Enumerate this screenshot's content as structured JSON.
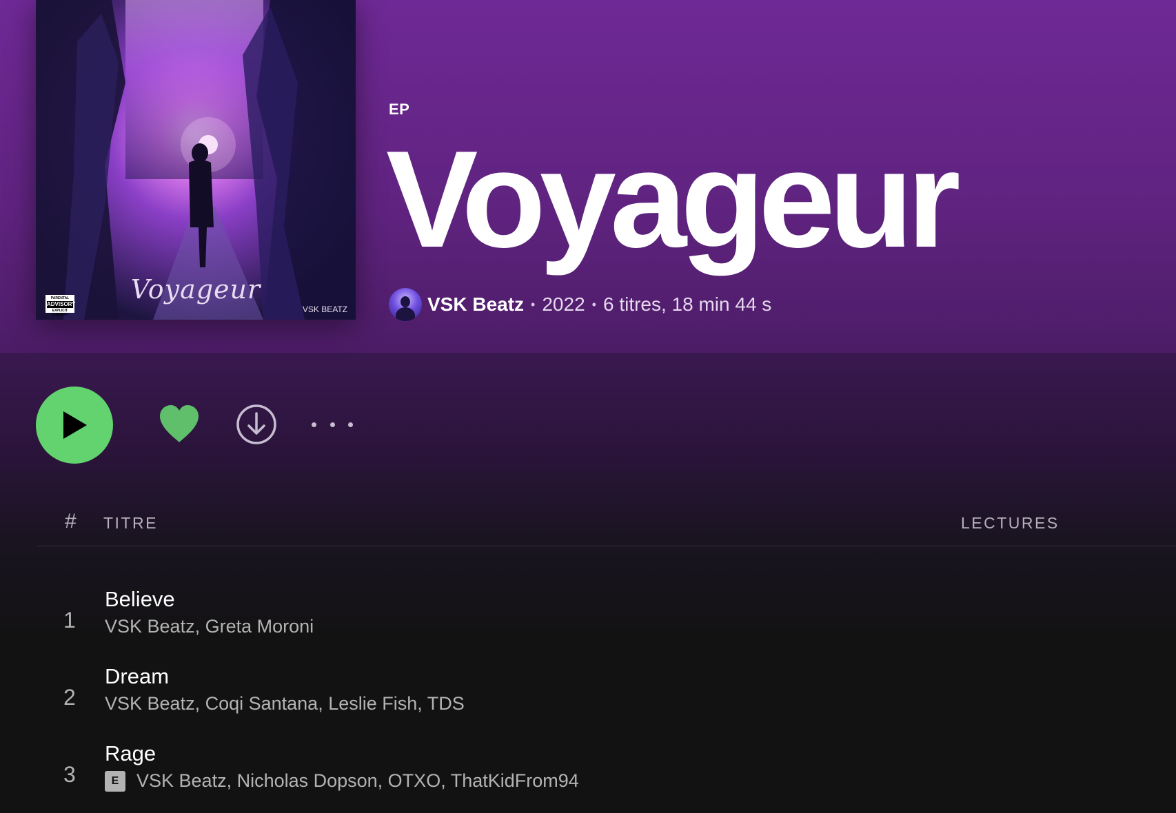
{
  "album": {
    "type": "EP",
    "title": "Voyageur",
    "cover": {
      "title_text": "Voyageur",
      "artist_text": "VSK BEATZ",
      "advisory_top": "PARENTAL",
      "advisory_mid": "ADVISORY",
      "advisory_bottom": "EXPLICIT CONTENT"
    },
    "artist": "VSK Beatz",
    "year": "2022",
    "summary": "6 titres, 18 min 44 s",
    "separator": "•"
  },
  "actions": {
    "play_icon": "play-icon",
    "like_icon": "heart-icon",
    "download_icon": "download-icon",
    "more_icon": "more-icon",
    "accent_color": "#62d36f"
  },
  "table": {
    "headers": {
      "number": "#",
      "title": "TITRE",
      "plays": "LECTURES"
    },
    "tracks": [
      {
        "number": "1",
        "title": "Believe",
        "artists": "VSK Beatz, Greta Moroni",
        "explicit": false
      },
      {
        "number": "2",
        "title": "Dream",
        "artists": "VSK Beatz, Coqi Santana, Leslie Fish, TDS",
        "explicit": false
      },
      {
        "number": "3",
        "title": "Rage",
        "artists": "VSK Beatz, Nicholas Dopson, OTXO, ThatKidFrom94",
        "explicit": true,
        "explicit_label": "E"
      }
    ]
  }
}
